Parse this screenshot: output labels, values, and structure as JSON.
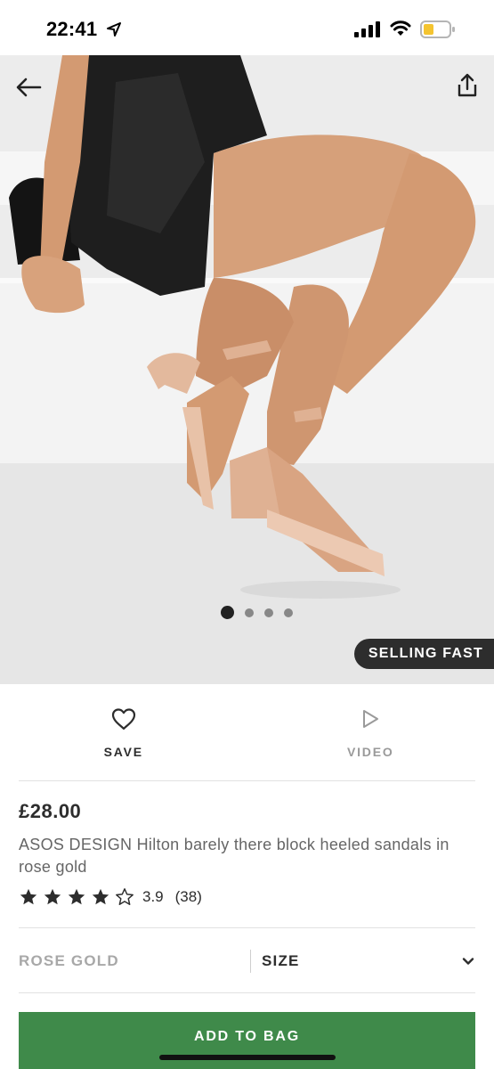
{
  "status": {
    "time": "22:41"
  },
  "hero": {
    "badge": "SELLING FAST",
    "dots_count": 4,
    "active_dot": 0
  },
  "actions": {
    "save_label": "SAVE",
    "video_label": "VIDEO"
  },
  "product": {
    "price": "£28.00",
    "title": "ASOS DESIGN Hilton barely there block heeled sandals in rose gold",
    "rating": {
      "stars_filled": 4,
      "stars_total": 5,
      "value": "3.9",
      "count": "(38)"
    }
  },
  "selectors": {
    "colour": "ROSE GOLD",
    "size": "SIZE"
  },
  "cta": {
    "add_to_bag": "ADD TO BAG"
  },
  "colors": {
    "accent_green": "#3f8a4a",
    "text_dark": "#2d2d2d",
    "badge_bg": "#2d2d2d"
  }
}
